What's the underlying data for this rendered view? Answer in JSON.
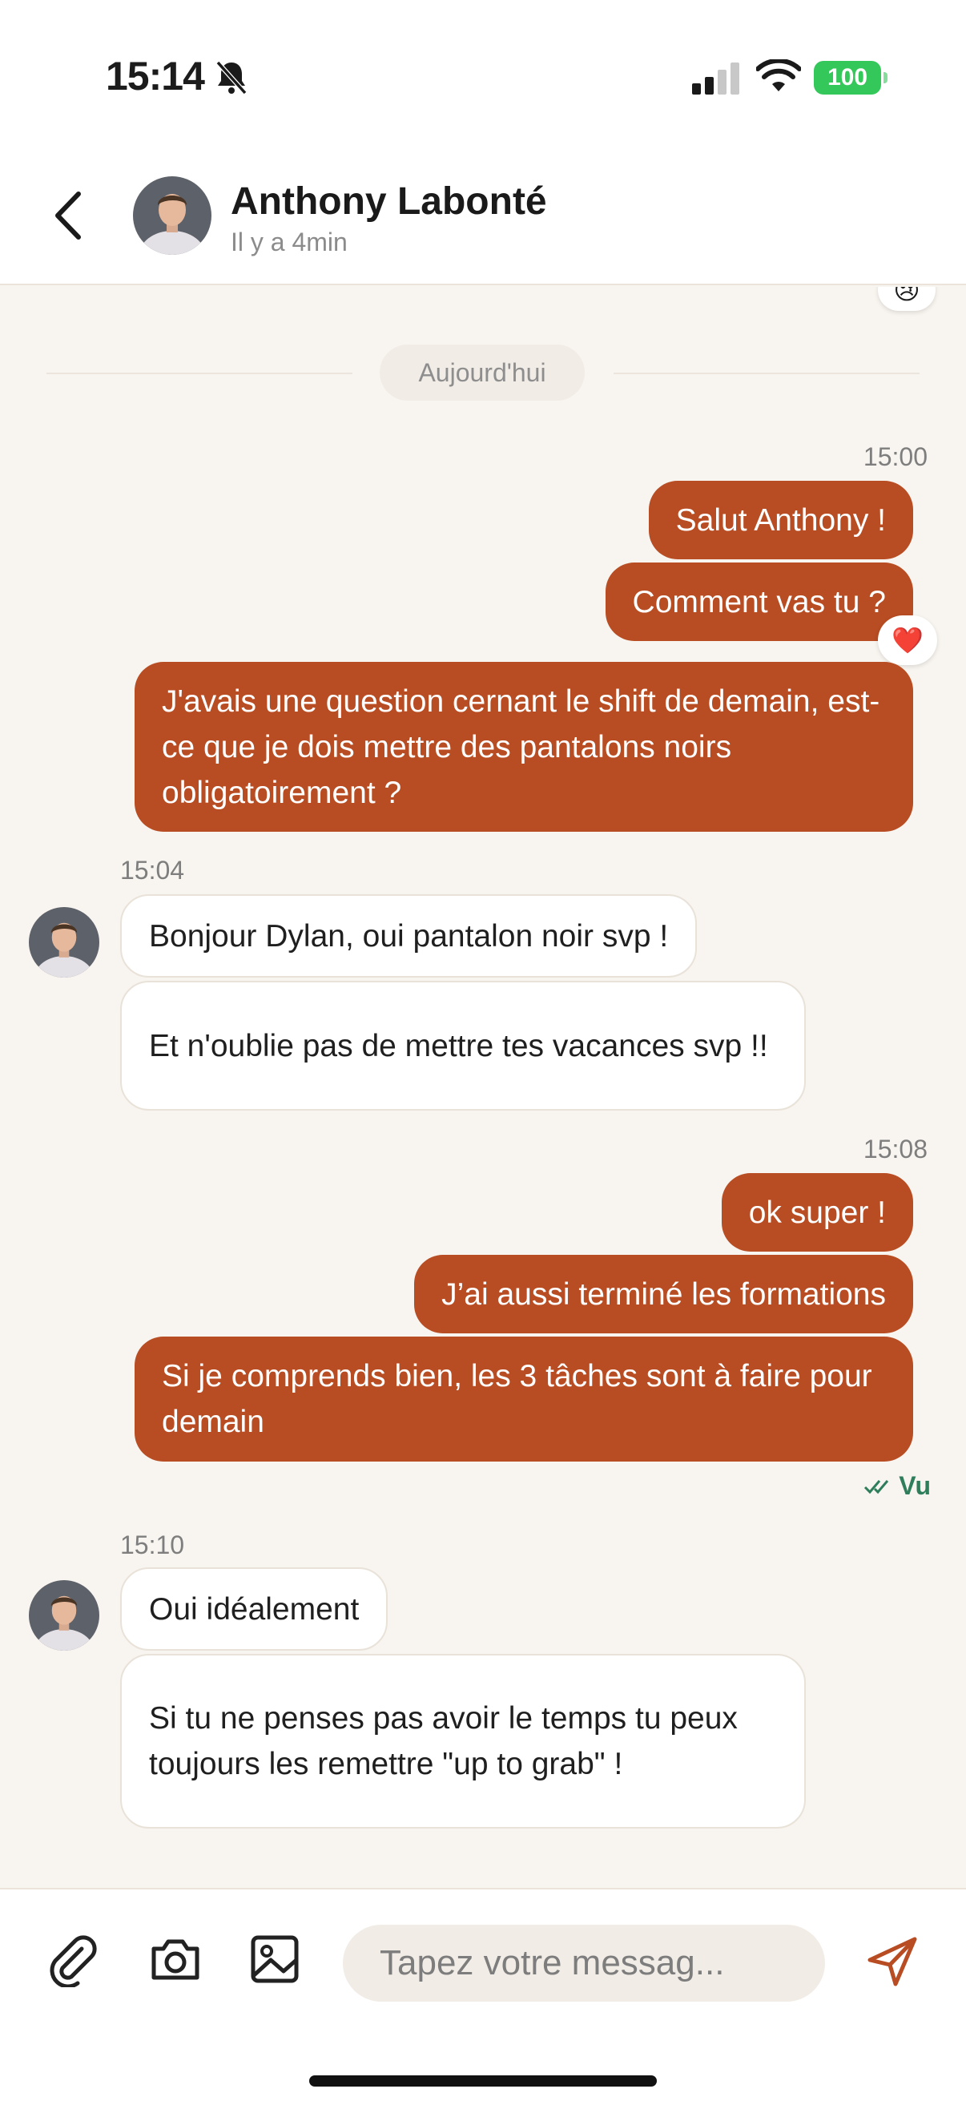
{
  "status_bar": {
    "time": "15:14",
    "battery": "100",
    "icons": [
      "bell-slash-icon",
      "signal-icon",
      "wifi-icon"
    ]
  },
  "header": {
    "name": "Anthony Labonté",
    "status": "Il y a 4min",
    "back_icon": "chevron-left-icon"
  },
  "chat": {
    "date_divider": "Aujourd'hui",
    "groups": [
      {
        "sender": "me",
        "time": "15:00",
        "messages": [
          {
            "text": "Salut Anthony !"
          },
          {
            "text": "Comment vas tu ?",
            "reaction": "❤️"
          },
          {
            "text": "J'avais une question cernant le shift de demain, est-ce que je dois mettre des pantalons noirs obligatoirement ?"
          }
        ]
      },
      {
        "sender": "Anthony",
        "time": "15:04",
        "messages": [
          {
            "text": "Bonjour Dylan, oui pantalon noir svp !"
          },
          {
            "text": "Et n'oublie pas de mettre tes vacances svp !!"
          }
        ]
      },
      {
        "sender": "me",
        "time": "15:08",
        "messages": [
          {
            "text": "ok super !"
          },
          {
            "text": "J’ai aussi terminé les formations"
          },
          {
            "text": "Si je comprends bien, les 3 tâches sont à faire pour demain"
          }
        ],
        "seen": "Vu"
      },
      {
        "sender": "Anthony",
        "time": "15:10",
        "messages": [
          {
            "text": "Oui idéalement"
          },
          {
            "text": "Si tu ne penses pas avoir le temps tu peux toujours les remettre \"up to grab\" !"
          }
        ]
      }
    ],
    "top_reaction": "😢"
  },
  "input_bar": {
    "placeholder": "Tapez votre messag...",
    "icons": [
      "paperclip-icon",
      "camera-icon",
      "image-icon",
      "send-icon"
    ]
  },
  "colors": {
    "outgoing": "#b84c22",
    "background": "#f8f4ef",
    "seen": "#2e7d5b",
    "battery": "#34c759"
  }
}
